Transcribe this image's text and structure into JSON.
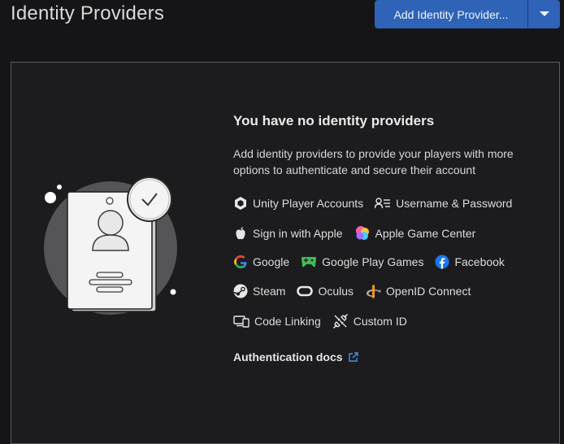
{
  "header": {
    "title": "Identity Providers",
    "add_button_label": "Add Identity Provider..."
  },
  "empty_state": {
    "heading": "You have no identity providers",
    "description": "Add identity providers to provide your players with more options to authenticate and secure their account",
    "docs_link": "Authentication docs"
  },
  "providers": {
    "unity": "Unity Player Accounts",
    "username": "Username & Password",
    "apple": "Sign in with Apple",
    "game_center": "Apple Game Center",
    "google": "Google",
    "google_play": "Google Play Games",
    "facebook": "Facebook",
    "steam": "Steam",
    "oculus": "Oculus",
    "openid": "OpenID Connect",
    "code_linking": "Code Linking",
    "custom_id": "Custom ID"
  },
  "colors": {
    "accent": "#2f63b8",
    "background": "#151517",
    "card": "#1c1c1e",
    "facebook": "#1877f2",
    "google_play": "#3fba5a",
    "openid": "#f7931e"
  }
}
